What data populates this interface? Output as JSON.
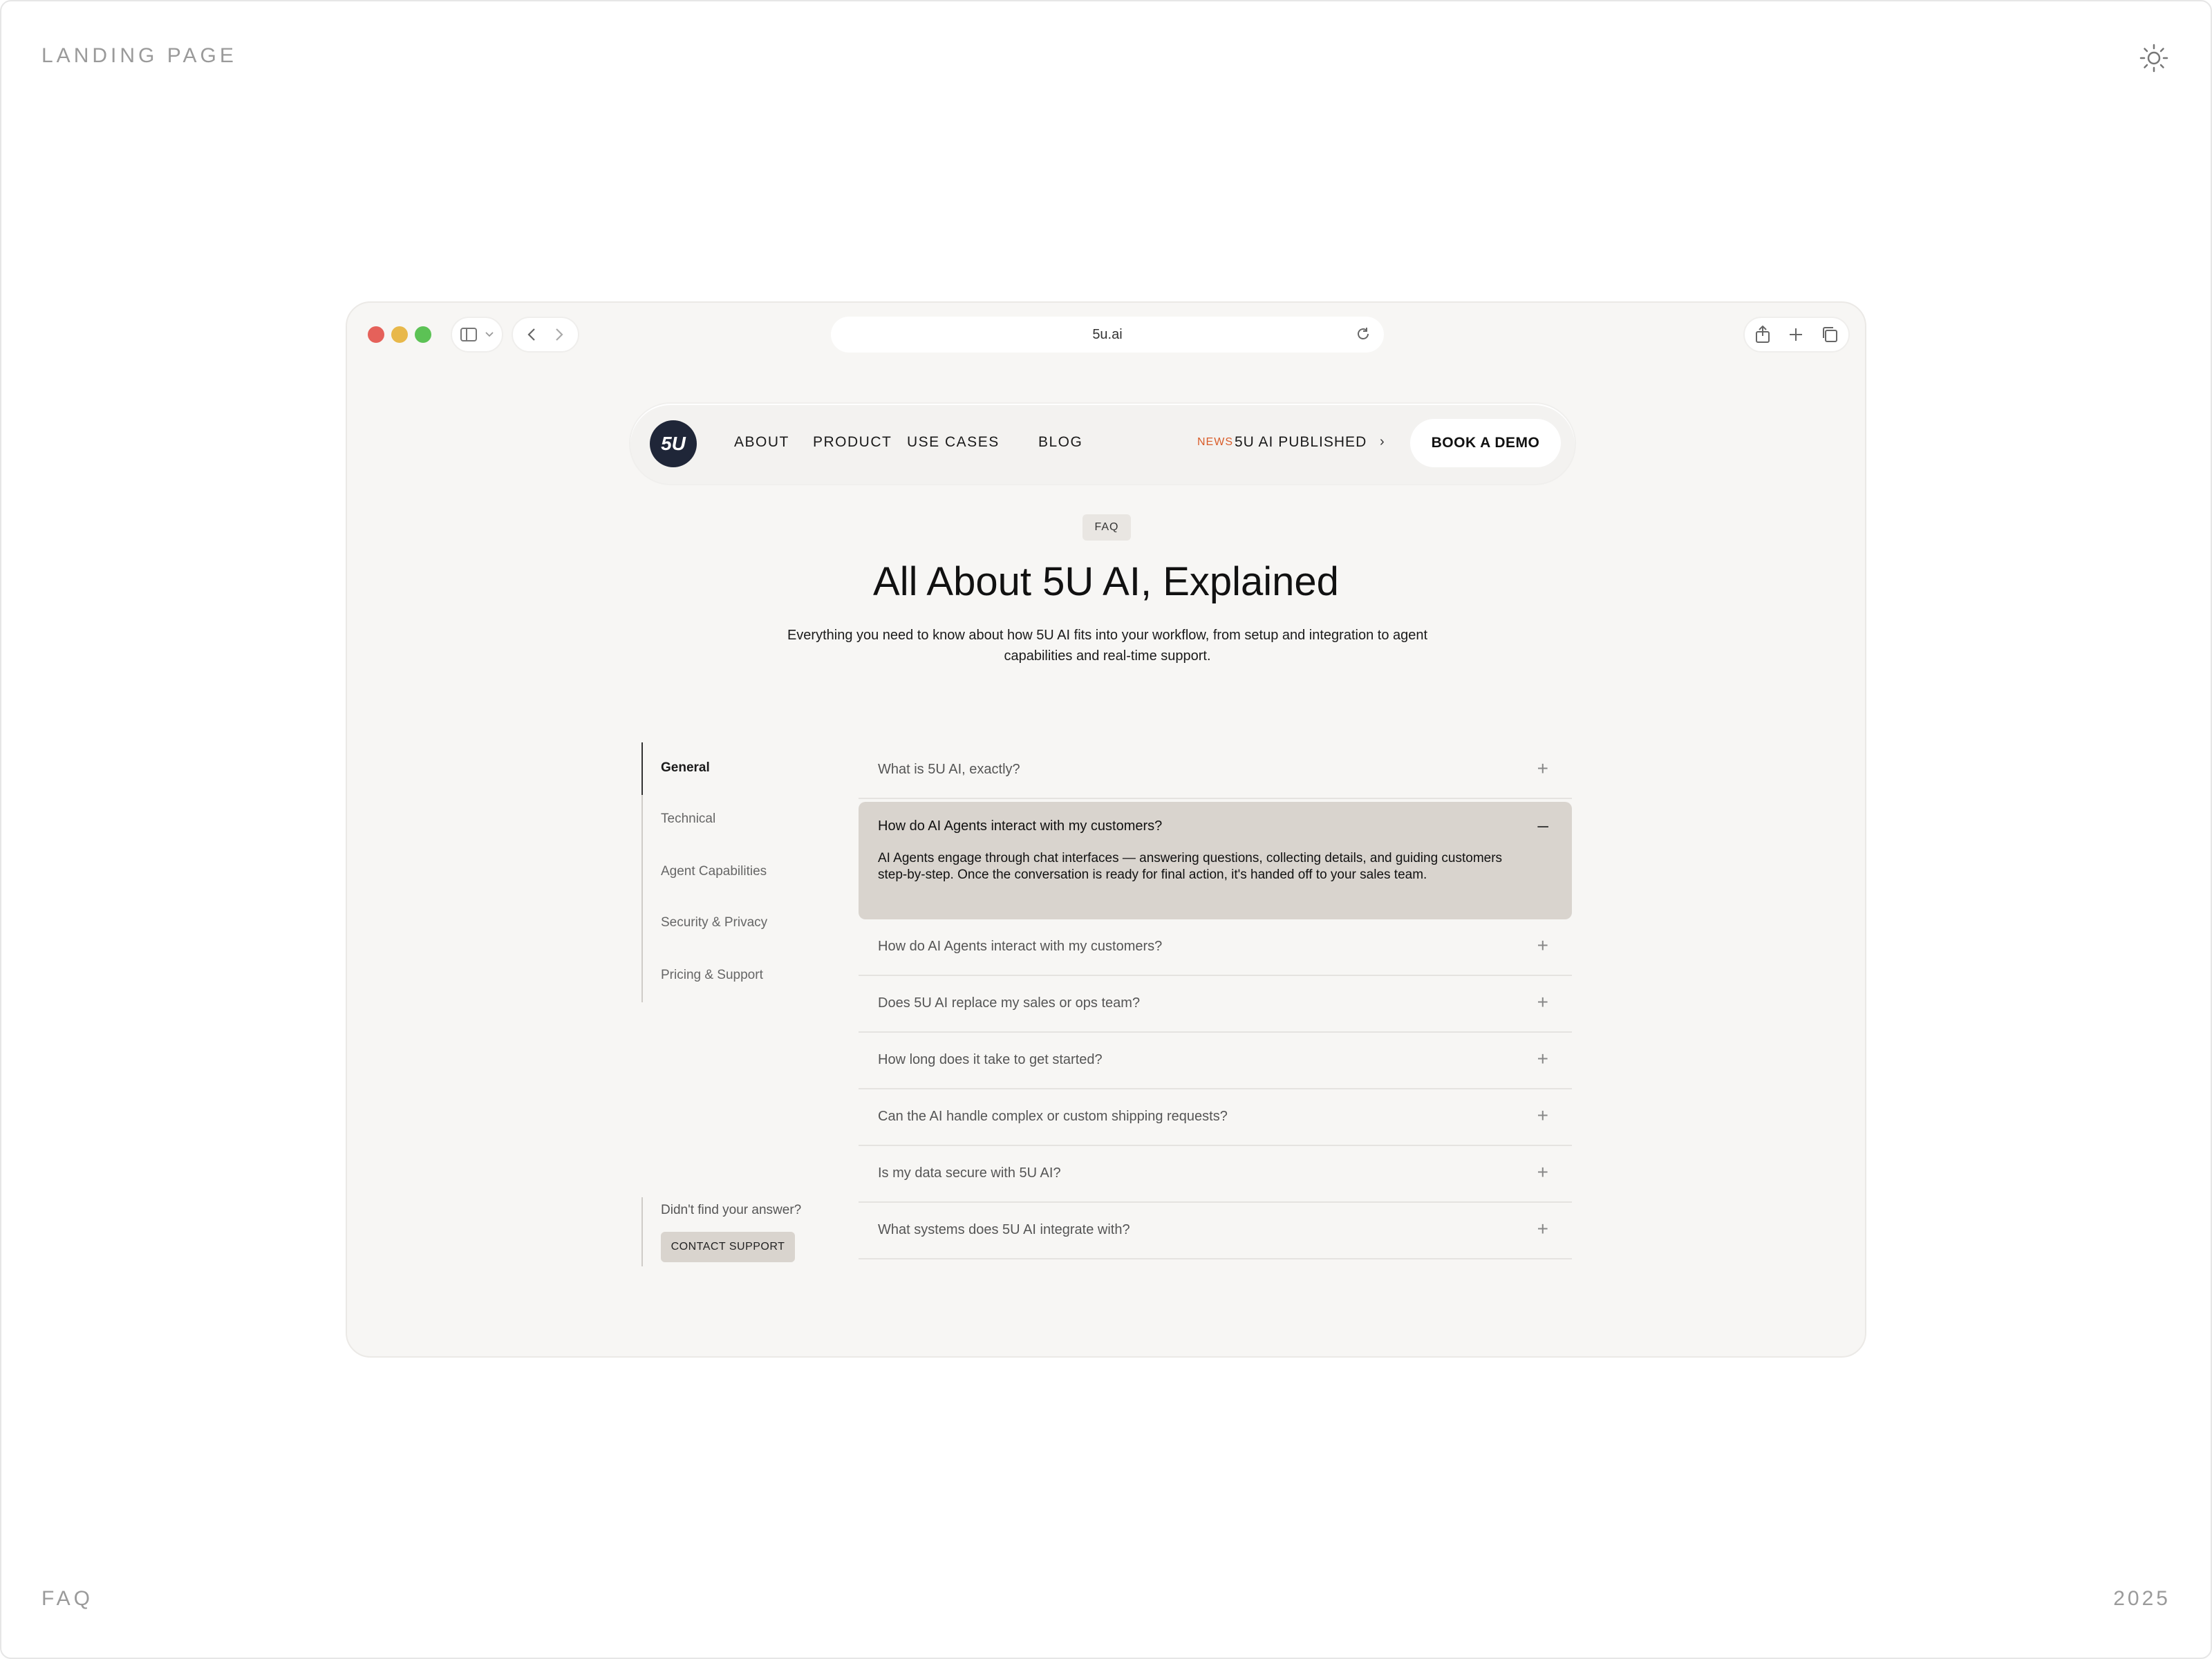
{
  "page": {
    "corner_top_left": "LANDING PAGE",
    "corner_bottom_left": "FAQ",
    "corner_bottom_right": "2025",
    "theme_icon": "sun-icon"
  },
  "browser": {
    "url": "5u.ai",
    "icons": [
      "sidebar-icon",
      "chevron-down-icon",
      "back-icon",
      "forward-icon",
      "reload-icon",
      "share-icon",
      "plus-icon",
      "tabs-icon"
    ]
  },
  "nav": {
    "logo": "5U",
    "links": [
      "ABOUT",
      "PRODUCT",
      "USE CASES",
      "BLOG"
    ],
    "news_tag": "NEWS",
    "news_text": "5U AI PUBLISHED",
    "news_chevron": "›",
    "cta": "BOOK A DEMO"
  },
  "hero": {
    "badge": "FAQ",
    "title": "All About 5U AI, Explained",
    "subtitle": "Everything you need to know about how 5U AI fits into your workflow, from setup and integration to agent capabilities and real-time support."
  },
  "sidebar": {
    "items": [
      "General",
      "Technical",
      "Agent Capabilities",
      "Security & Privacy",
      "Pricing & Support"
    ],
    "active": "General",
    "help_text": "Didn't find your answer?",
    "contact_button": "CONTACT SUPPORT"
  },
  "faq": {
    "items": [
      {
        "question": "What is 5U AI, exactly?",
        "toggle": "+"
      },
      {
        "question": "How do AI Agents interact with my customers?",
        "toggle": "–",
        "answer": "AI Agents engage through chat interfaces — answering questions, collecting details, and guiding customers step-by-step. Once the conversation is ready for final action, it's handed off to your sales team."
      },
      {
        "question": "How do AI Agents interact with my customers?",
        "toggle": "+"
      },
      {
        "question": "Does 5U AI replace my sales or ops team?",
        "toggle": "+"
      },
      {
        "question": "How long does it take to get started?",
        "toggle": "+"
      },
      {
        "question": "Can the AI handle complex or custom shipping requests?",
        "toggle": "+"
      },
      {
        "question": "Is my data secure with 5U AI?",
        "toggle": "+"
      },
      {
        "question": "What systems does 5U AI integrate with?",
        "toggle": "+"
      }
    ]
  },
  "colors": {
    "accent_news": "#d95d2a",
    "logo_bg": "#1f2638",
    "open_item_bg": "#d9d4ce",
    "window_bg": "#f7f6f4"
  }
}
